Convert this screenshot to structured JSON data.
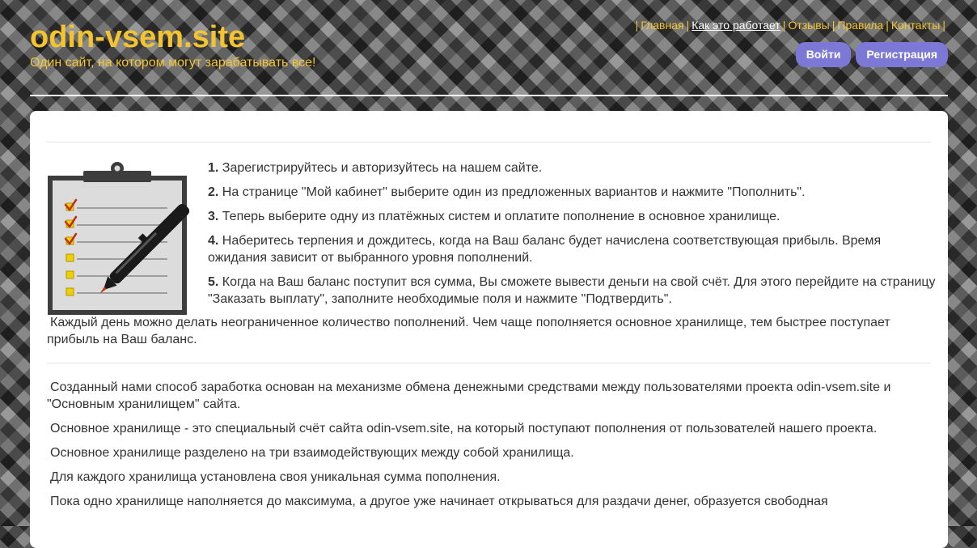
{
  "header": {
    "site_title": "odin-vsem.site",
    "tagline": "Один сайт, на котором могут зарабатывать все!"
  },
  "nav": {
    "items": [
      {
        "label": "Главная",
        "active": false
      },
      {
        "label": "Как это работает",
        "active": true
      },
      {
        "label": "Отзывы",
        "active": false
      },
      {
        "label": "Правила",
        "active": false
      },
      {
        "label": "Контакты",
        "active": false
      }
    ],
    "separator": "|"
  },
  "auth": {
    "login_label": "Войти",
    "register_label": "Регистрация"
  },
  "steps": [
    {
      "num": "1.",
      "text": " Зарегистрируйтесь и авторизуйтесь на нашем сайте."
    },
    {
      "num": "2.",
      "text": " На странице \"Мой кабинет\" выберите один из предложенных вариантов и нажмите \"Пополнить\"."
    },
    {
      "num": "3.",
      "text": " Теперь выберите одну из платёжных систем и оплатите пополнение в основное хранилище."
    },
    {
      "num": "4.",
      "text": " Наберитесь терпения и дождитесь, когда на Ваш баланс будет начислена соответствующая прибыль. Время ожидания зависит от выбранного уровня пополнений."
    },
    {
      "num": "5.",
      "text": " Когда на Ваш баланс поступит вся сумма, Вы сможете вывести деньги на свой счёт. Для этого перейдите на страницу \"Заказать выплату\", заполните необходимые поля и нажмите \"Подтвердить\"."
    }
  ],
  "after_steps": "Каждый день можно делать неограниченное количество пополнений. Чем чаще пополняется основное хранилище, тем быстрее поступает прибыль на Ваш баланс.",
  "section2": [
    "Созданный нами способ заработка основан на механизме обмена денежными средствами между пользователями проекта odin-vsem.site и \"Основным хранилищем\" сайта.",
    "Основное хранилище - это специальный счёт сайта odin-vsem.site, на который поступают пополнения от пользователей нашего проекта.",
    "Основное хранилище разделено на три взаимодействующих между собой хранилища.",
    "Для каждого хранилища установлена своя уникальная сумма пополнения.",
    "Пока одно хранилище наполняется до максимума, а другое уже начинает открываться для раздачи денег, образуется свободная"
  ],
  "colors": {
    "brand_yellow": "#f4c430",
    "button_purple": "#7b78d6",
    "text": "#333333"
  },
  "icons": {
    "illustration": "clipboard-checklist-pen-icon"
  }
}
